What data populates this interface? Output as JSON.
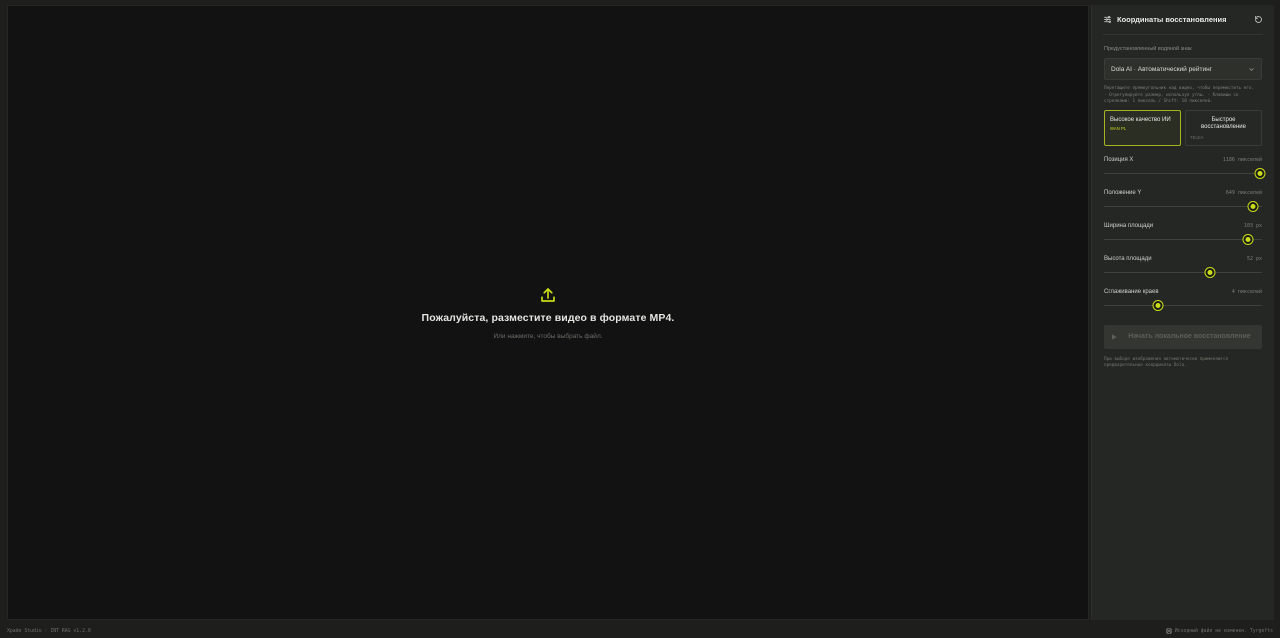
{
  "upload": {
    "title": "Пожалуйста, разместите видео в формате MP4.",
    "subtitle": "Или нажмите, чтобы выбрать файл."
  },
  "panel": {
    "title": "Координаты восстановления",
    "preset_label": "Предустановленный водяной знак",
    "preset_value": "Dola AI · Автоматический рейтинг",
    "hint": "Перетащите прямоугольник над видео, чтобы переместить его.\n· Отрегулируйте размер, используя углы. · Клавиши со\nстрелками: 1 пиксель / Shift: 10 пикселей.",
    "modes": [
      {
        "label": "Высокое качество ИИ",
        "tag": "WAN PL",
        "active": true
      },
      {
        "label": "Быстрое восстановление",
        "tag": "TELEA",
        "active": false
      }
    ],
    "sliders": [
      {
        "label": "Позиция X",
        "value_text": "1186 пикселей",
        "fraction": 0.985
      },
      {
        "label": "Положение Y",
        "value_text": "649 пикселей",
        "fraction": 0.945
      },
      {
        "label": "Ширина площади",
        "value_text": "103 px",
        "fraction": 0.91
      },
      {
        "label": "Высота площади",
        "value_text": "52 px",
        "fraction": 0.67
      },
      {
        "label": "Сглаживание краев",
        "value_text": "4 пикселей",
        "fraction": 0.34
      }
    ],
    "start_label": "Начать локальное восстановление",
    "footer_note": "При выборе изображения автоматически применяются предварительные координаты Dola."
  },
  "status": {
    "left": "Xpade Studio · INT RAG v1.2.0",
    "right": "Исходный файл не изменен. Tyrgefts"
  },
  "colors": {
    "accent": "#c9dc1a",
    "stage_bg": "#121212",
    "panel_bg": "#252724"
  },
  "icons": {
    "upload": "upload-icon",
    "header": "sliders-icon",
    "reset": "reset-icon",
    "dropdown": "chevron-down-icon",
    "start": "play-icon",
    "status": "disk-icon"
  }
}
